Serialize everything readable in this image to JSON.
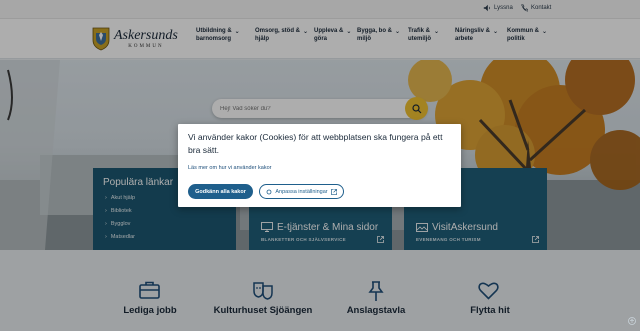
{
  "utility": {
    "listen": "Lyssna",
    "contact": "Kontakt"
  },
  "logo": {
    "name": "Askersunds",
    "sub": "KOMMUN"
  },
  "nav": [
    {
      "line1": "Utbildning &",
      "line2": "barnomsorg"
    },
    {
      "line1": "Omsorg, stöd &",
      "line2": "hjälp"
    },
    {
      "line1": "Uppleva &",
      "line2": "göra"
    },
    {
      "line1": "Bygga, bo &",
      "line2": "miljö"
    },
    {
      "line1": "Trafik &",
      "line2": "utemiljö"
    },
    {
      "line1": "Näringsliv &",
      "line2": "arbete"
    },
    {
      "line1": "Kommun &",
      "line2": "politik"
    }
  ],
  "search": {
    "placeholder": "Hej! Vad söker du?"
  },
  "quick": {
    "title": "Populära länkar",
    "links": [
      "Akut hjälp",
      "Bibliotek",
      "Bygglov",
      "Matsedlar"
    ]
  },
  "tiles": [
    {
      "title": "E-tjänster & Mina sidor",
      "sub": "BLANKETTER OCH SJÄLVSERVICE"
    },
    {
      "title": "VisitAskersund",
      "sub": "EVENEMANG OCH TURISM"
    }
  ],
  "bottom_links": [
    "Lediga jobb",
    "Kulturhuset Sjöängen",
    "Anslagstavla",
    "Flytta hit"
  ],
  "cookie": {
    "message": "Vi använder kakor (Cookies) för att webbplatsen ska fungera på ett bra sätt.",
    "link": "Läs mer om hur vi använder kakor",
    "accept": "Godkänn alla kakor",
    "customize": "Anpassa inställningar"
  },
  "colors": {
    "accent": "#1f5f8c",
    "tile": "#1f5f7a",
    "search_button": "#f1c232"
  }
}
